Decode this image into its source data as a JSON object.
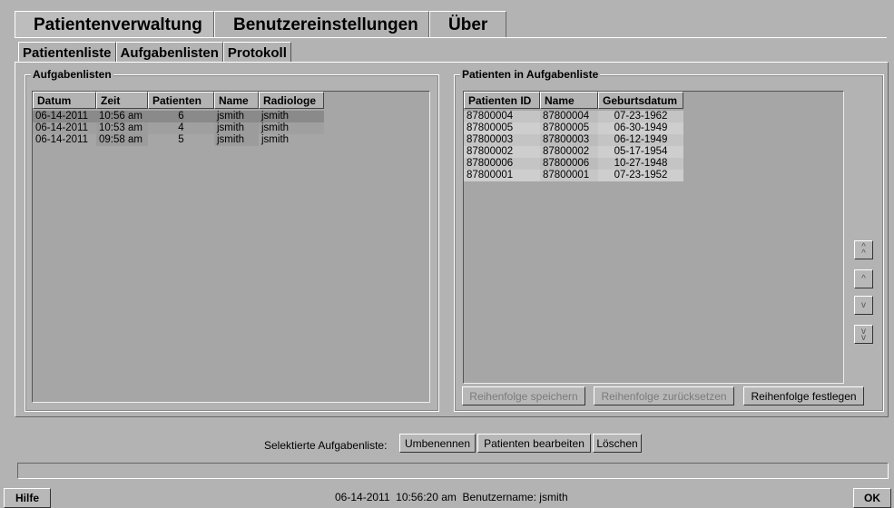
{
  "top_tabs": [
    "Patientenverwaltung",
    "Benutzereinstellungen",
    "Über"
  ],
  "sub_tabs": [
    "Patientenliste",
    "Aufgabenlisten",
    "Protokoll"
  ],
  "left_group": {
    "title": "Aufgabenlisten",
    "columns": [
      "Datum",
      "Zeit",
      "Patienten",
      "Name",
      "Radiologe"
    ],
    "rows": [
      [
        "06-14-2011",
        "10:56 am",
        "6",
        "jsmith",
        "jsmith"
      ],
      [
        "06-14-2011",
        "10:53 am",
        "4",
        "jsmith",
        "jsmith"
      ],
      [
        "06-14-2011",
        "09:58 am",
        "5",
        "jsmith",
        "jsmith"
      ]
    ]
  },
  "right_group": {
    "title": "Patienten in Aufgabenliste",
    "columns": [
      "Patienten ID",
      "Name",
      "Geburtsdatum"
    ],
    "rows": [
      [
        "87800004",
        "87800004",
        "07-23-1962"
      ],
      [
        "87800005",
        "87800005",
        "06-30-1949"
      ],
      [
        "87800003",
        "87800003",
        "06-12-1949"
      ],
      [
        "87800002",
        "87800002",
        "05-17-1954"
      ],
      [
        "87800006",
        "87800006",
        "10-27-1948"
      ],
      [
        "87800001",
        "87800001",
        "07-23-1952"
      ]
    ],
    "buttons": {
      "save_order": "Reihenfolge speichern",
      "reset_order": "Reihenfolge zurücksetzen",
      "set_order": "Reihenfolge festlegen"
    }
  },
  "actions": {
    "label": "Selektierte Aufgabenliste:",
    "rename": "Umbenennen",
    "edit_patients": "Patienten bearbeiten",
    "delete": "Löschen"
  },
  "statusbar": {
    "help": "Hilfe",
    "datetime": "06-14-2011  10:56:20 am",
    "user_label": "Benutzername:",
    "user": "jsmith",
    "ok": "OK"
  }
}
